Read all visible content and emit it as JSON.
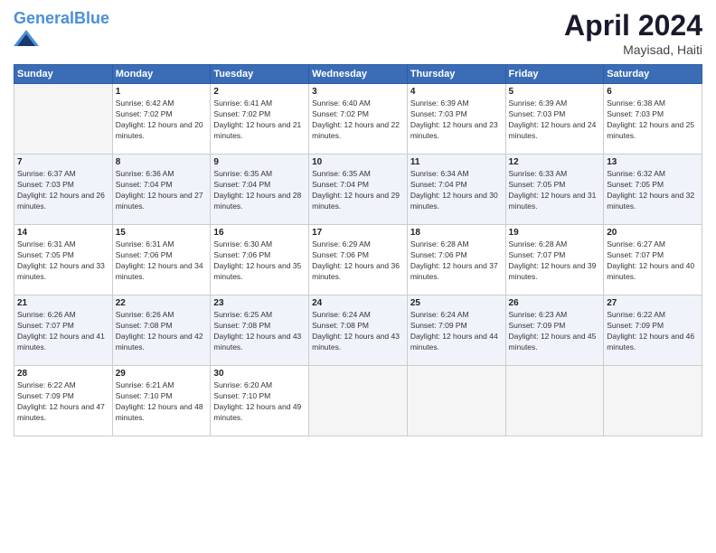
{
  "logo": {
    "line1": "General",
    "line2": "Blue"
  },
  "header": {
    "month": "April 2024",
    "location": "Mayisad, Haiti"
  },
  "weekdays": [
    "Sunday",
    "Monday",
    "Tuesday",
    "Wednesday",
    "Thursday",
    "Friday",
    "Saturday"
  ],
  "weeks": [
    [
      {
        "num": "",
        "sunrise": "",
        "sunset": "",
        "daylight": ""
      },
      {
        "num": "1",
        "sunrise": "Sunrise: 6:42 AM",
        "sunset": "Sunset: 7:02 PM",
        "daylight": "Daylight: 12 hours and 20 minutes."
      },
      {
        "num": "2",
        "sunrise": "Sunrise: 6:41 AM",
        "sunset": "Sunset: 7:02 PM",
        "daylight": "Daylight: 12 hours and 21 minutes."
      },
      {
        "num": "3",
        "sunrise": "Sunrise: 6:40 AM",
        "sunset": "Sunset: 7:02 PM",
        "daylight": "Daylight: 12 hours and 22 minutes."
      },
      {
        "num": "4",
        "sunrise": "Sunrise: 6:39 AM",
        "sunset": "Sunset: 7:03 PM",
        "daylight": "Daylight: 12 hours and 23 minutes."
      },
      {
        "num": "5",
        "sunrise": "Sunrise: 6:39 AM",
        "sunset": "Sunset: 7:03 PM",
        "daylight": "Daylight: 12 hours and 24 minutes."
      },
      {
        "num": "6",
        "sunrise": "Sunrise: 6:38 AM",
        "sunset": "Sunset: 7:03 PM",
        "daylight": "Daylight: 12 hours and 25 minutes."
      }
    ],
    [
      {
        "num": "7",
        "sunrise": "Sunrise: 6:37 AM",
        "sunset": "Sunset: 7:03 PM",
        "daylight": "Daylight: 12 hours and 26 minutes."
      },
      {
        "num": "8",
        "sunrise": "Sunrise: 6:36 AM",
        "sunset": "Sunset: 7:04 PM",
        "daylight": "Daylight: 12 hours and 27 minutes."
      },
      {
        "num": "9",
        "sunrise": "Sunrise: 6:35 AM",
        "sunset": "Sunset: 7:04 PM",
        "daylight": "Daylight: 12 hours and 28 minutes."
      },
      {
        "num": "10",
        "sunrise": "Sunrise: 6:35 AM",
        "sunset": "Sunset: 7:04 PM",
        "daylight": "Daylight: 12 hours and 29 minutes."
      },
      {
        "num": "11",
        "sunrise": "Sunrise: 6:34 AM",
        "sunset": "Sunset: 7:04 PM",
        "daylight": "Daylight: 12 hours and 30 minutes."
      },
      {
        "num": "12",
        "sunrise": "Sunrise: 6:33 AM",
        "sunset": "Sunset: 7:05 PM",
        "daylight": "Daylight: 12 hours and 31 minutes."
      },
      {
        "num": "13",
        "sunrise": "Sunrise: 6:32 AM",
        "sunset": "Sunset: 7:05 PM",
        "daylight": "Daylight: 12 hours and 32 minutes."
      }
    ],
    [
      {
        "num": "14",
        "sunrise": "Sunrise: 6:31 AM",
        "sunset": "Sunset: 7:05 PM",
        "daylight": "Daylight: 12 hours and 33 minutes."
      },
      {
        "num": "15",
        "sunrise": "Sunrise: 6:31 AM",
        "sunset": "Sunset: 7:06 PM",
        "daylight": "Daylight: 12 hours and 34 minutes."
      },
      {
        "num": "16",
        "sunrise": "Sunrise: 6:30 AM",
        "sunset": "Sunset: 7:06 PM",
        "daylight": "Daylight: 12 hours and 35 minutes."
      },
      {
        "num": "17",
        "sunrise": "Sunrise: 6:29 AM",
        "sunset": "Sunset: 7:06 PM",
        "daylight": "Daylight: 12 hours and 36 minutes."
      },
      {
        "num": "18",
        "sunrise": "Sunrise: 6:28 AM",
        "sunset": "Sunset: 7:06 PM",
        "daylight": "Daylight: 12 hours and 37 minutes."
      },
      {
        "num": "19",
        "sunrise": "Sunrise: 6:28 AM",
        "sunset": "Sunset: 7:07 PM",
        "daylight": "Daylight: 12 hours and 39 minutes."
      },
      {
        "num": "20",
        "sunrise": "Sunrise: 6:27 AM",
        "sunset": "Sunset: 7:07 PM",
        "daylight": "Daylight: 12 hours and 40 minutes."
      }
    ],
    [
      {
        "num": "21",
        "sunrise": "Sunrise: 6:26 AM",
        "sunset": "Sunset: 7:07 PM",
        "daylight": "Daylight: 12 hours and 41 minutes."
      },
      {
        "num": "22",
        "sunrise": "Sunrise: 6:26 AM",
        "sunset": "Sunset: 7:08 PM",
        "daylight": "Daylight: 12 hours and 42 minutes."
      },
      {
        "num": "23",
        "sunrise": "Sunrise: 6:25 AM",
        "sunset": "Sunset: 7:08 PM",
        "daylight": "Daylight: 12 hours and 43 minutes."
      },
      {
        "num": "24",
        "sunrise": "Sunrise: 6:24 AM",
        "sunset": "Sunset: 7:08 PM",
        "daylight": "Daylight: 12 hours and 43 minutes."
      },
      {
        "num": "25",
        "sunrise": "Sunrise: 6:24 AM",
        "sunset": "Sunset: 7:09 PM",
        "daylight": "Daylight: 12 hours and 44 minutes."
      },
      {
        "num": "26",
        "sunrise": "Sunrise: 6:23 AM",
        "sunset": "Sunset: 7:09 PM",
        "daylight": "Daylight: 12 hours and 45 minutes."
      },
      {
        "num": "27",
        "sunrise": "Sunrise: 6:22 AM",
        "sunset": "Sunset: 7:09 PM",
        "daylight": "Daylight: 12 hours and 46 minutes."
      }
    ],
    [
      {
        "num": "28",
        "sunrise": "Sunrise: 6:22 AM",
        "sunset": "Sunset: 7:09 PM",
        "daylight": "Daylight: 12 hours and 47 minutes."
      },
      {
        "num": "29",
        "sunrise": "Sunrise: 6:21 AM",
        "sunset": "Sunset: 7:10 PM",
        "daylight": "Daylight: 12 hours and 48 minutes."
      },
      {
        "num": "30",
        "sunrise": "Sunrise: 6:20 AM",
        "sunset": "Sunset: 7:10 PM",
        "daylight": "Daylight: 12 hours and 49 minutes."
      },
      {
        "num": "",
        "sunrise": "",
        "sunset": "",
        "daylight": ""
      },
      {
        "num": "",
        "sunrise": "",
        "sunset": "",
        "daylight": ""
      },
      {
        "num": "",
        "sunrise": "",
        "sunset": "",
        "daylight": ""
      },
      {
        "num": "",
        "sunrise": "",
        "sunset": "",
        "daylight": ""
      }
    ]
  ]
}
